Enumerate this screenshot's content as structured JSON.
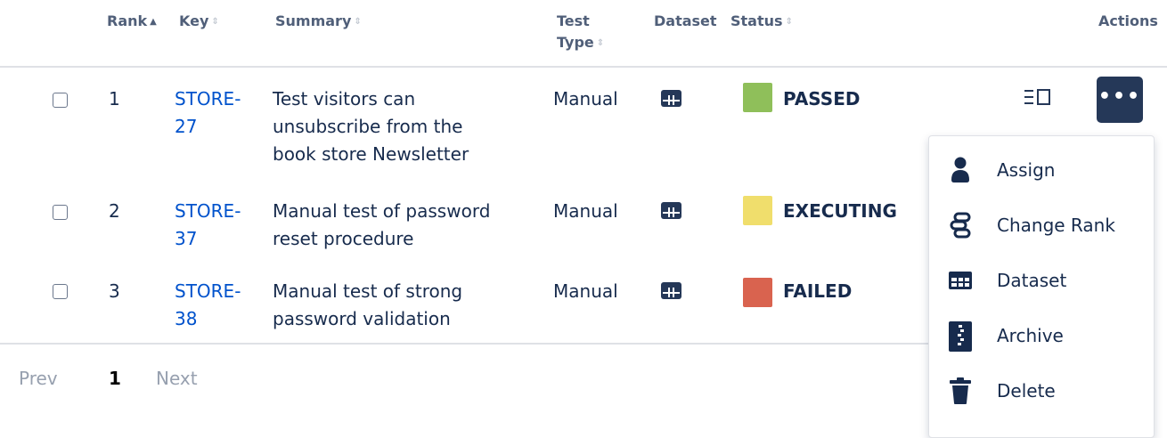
{
  "header": {
    "rank": "Rank",
    "key": "Key",
    "summary": "Summary",
    "test_type_line1": "Test",
    "test_type_line2": "Type",
    "dataset": "Dataset",
    "status": "Status",
    "actions": "Actions"
  },
  "rows": [
    {
      "rank": "1",
      "key_line1": "STORE-",
      "key_line2": "27",
      "summary": [
        "Test visitors can",
        "unsubscribe from the",
        "book store Newsletter"
      ],
      "test_type": "Manual",
      "status": "PASSED",
      "status_color": "#8fbf5a"
    },
    {
      "rank": "2",
      "key_line1": "STORE-",
      "key_line2": "37",
      "summary": [
        "Manual test of password",
        "reset procedure"
      ],
      "test_type": "Manual",
      "status": "EXECUTING",
      "status_color": "#f0de6c"
    },
    {
      "rank": "3",
      "key_line1": "STORE-",
      "key_line2": "38",
      "summary": [
        "Manual test of strong",
        "password validation"
      ],
      "test_type": "Manual",
      "status": "FAILED",
      "status_color": "#d9634f"
    }
  ],
  "actions": {
    "details_icon": "details-panel-icon",
    "more_icon": "more-icon"
  },
  "pagination": {
    "prev": "Prev",
    "current": "1",
    "next": "Next"
  },
  "menu": {
    "items": [
      {
        "label": "Assign",
        "icon": "person-icon"
      },
      {
        "label": "Change Rank",
        "icon": "rank-icon"
      },
      {
        "label": "Dataset",
        "icon": "dataset-icon"
      },
      {
        "label": "Archive",
        "icon": "archive-icon"
      },
      {
        "label": "Delete",
        "icon": "trash-icon"
      }
    ]
  },
  "colors": {
    "primary_dark": "#253858",
    "link": "#0052cc",
    "header_text": "#505f79"
  }
}
